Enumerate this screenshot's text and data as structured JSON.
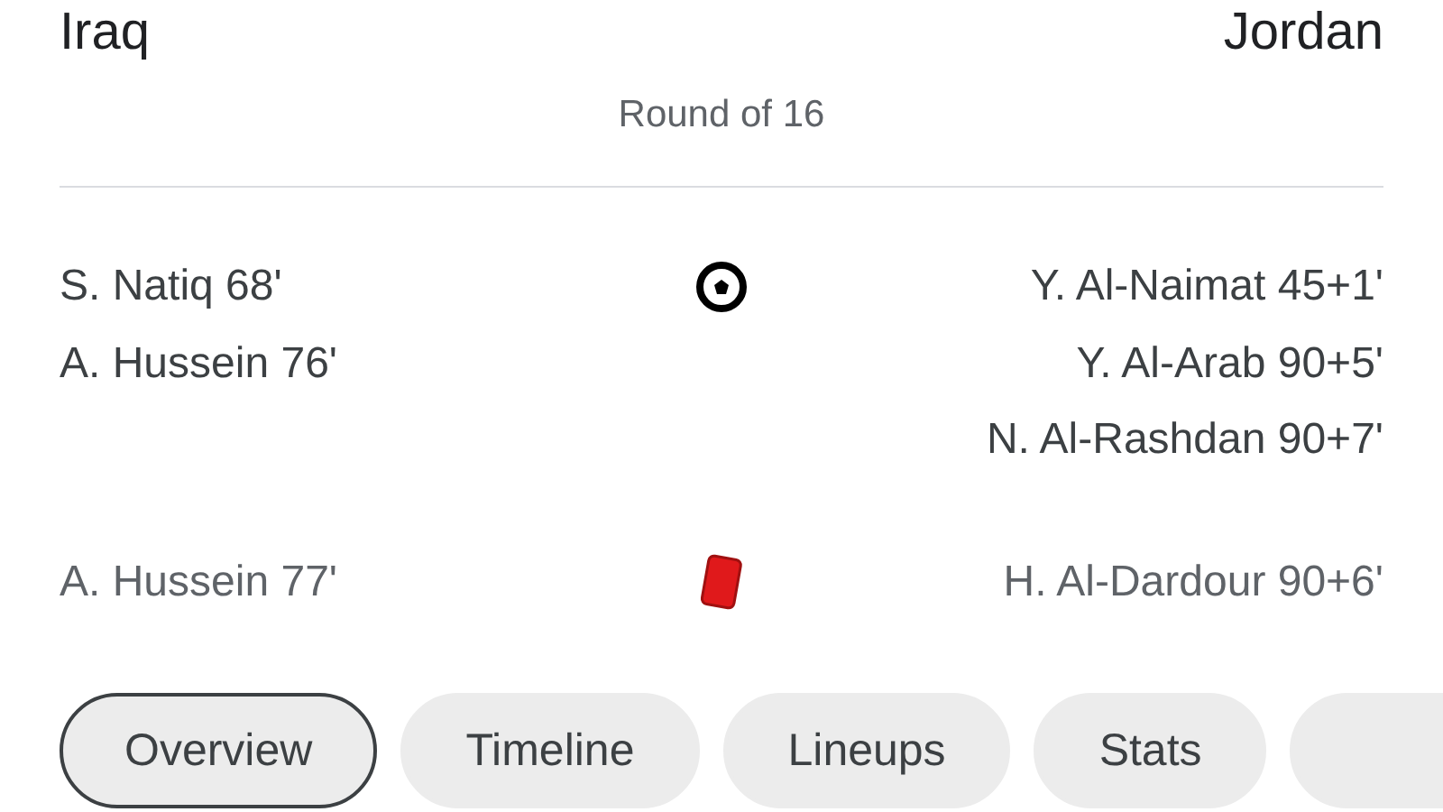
{
  "match": {
    "home_team": "Iraq",
    "away_team": "Jordan",
    "stage": "Round of 16"
  },
  "events": [
    {
      "kind": "goal",
      "home": [
        "S. Natiq 68'",
        "A. Hussein 76'"
      ],
      "away": [
        "Y. Al-Naimat 45+1'",
        "Y. Al-Arab 90+5'",
        "N. Al-Rashdan 90+7'"
      ]
    },
    {
      "kind": "red_card",
      "home": [
        "A. Hussein 77'"
      ],
      "away": [
        "H. Al-Dardour 90+6'"
      ]
    }
  ],
  "tabs": [
    {
      "label": "Overview",
      "selected": true
    },
    {
      "label": "Timeline",
      "selected": false
    },
    {
      "label": "Lineups",
      "selected": false
    },
    {
      "label": "Stats",
      "selected": false
    },
    {
      "selected": false
    }
  ]
}
